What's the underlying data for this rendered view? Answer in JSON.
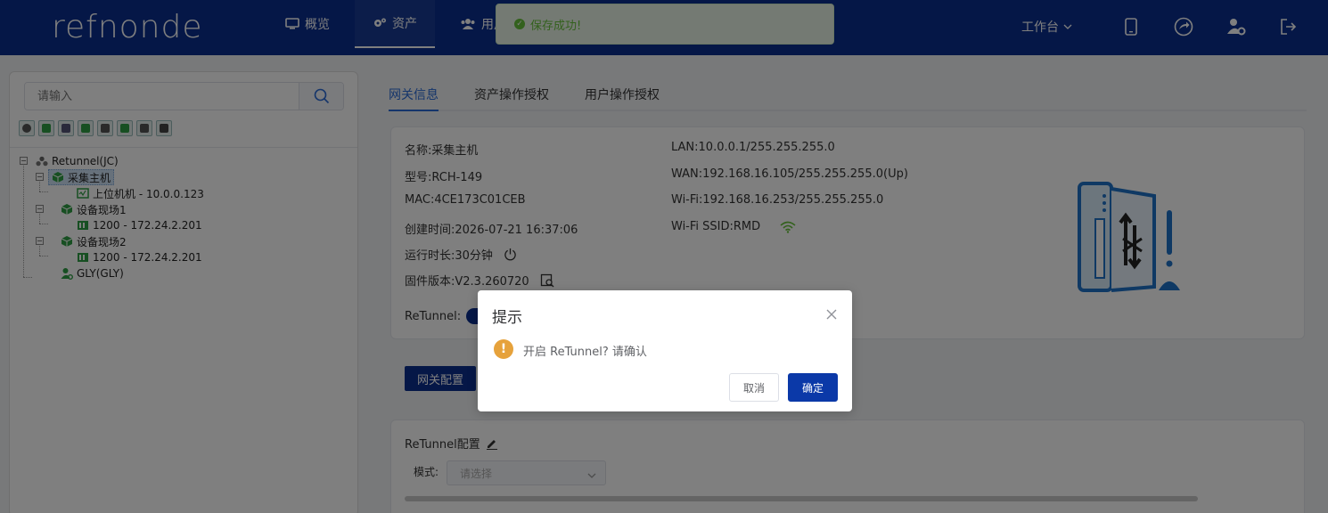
{
  "header": {
    "logo": "refnonde",
    "nav": [
      {
        "label": "概览",
        "icon": "monitor-icon"
      },
      {
        "label": "资产",
        "icon": "gears-icon"
      },
      {
        "label": "用户",
        "icon": "users-icon"
      }
    ],
    "toast": "保存成功!",
    "workbench": "工作台"
  },
  "sidebar": {
    "search_placeholder": "请输入",
    "tree": {
      "root": "Retunnel(JC)",
      "items": [
        {
          "label": "采集主机",
          "selected": true
        },
        {
          "label": "上位机机 - 10.0.0.123"
        },
        {
          "label": "设备现场1"
        },
        {
          "label": "1200 - 172.24.2.201"
        },
        {
          "label": "设备现场2"
        },
        {
          "label": "1200 - 172.24.2.201"
        },
        {
          "label": "GLY(GLY)"
        }
      ]
    }
  },
  "tabs": [
    {
      "label": "网关信息",
      "active": true
    },
    {
      "label": "资产操作授权"
    },
    {
      "label": "用户操作授权"
    }
  ],
  "gateway": {
    "name": "名称:采集主机",
    "model": "型号:RCH-149",
    "mac": "MAC:4CE173C01CEB",
    "created": "创建时间:2026-07-21 16:37:06",
    "uptime": "运行时长:30分钟",
    "firmware": "固件版本:V2.3.260720",
    "retunnel": "ReTunnel:",
    "lan": "LAN:10.0.0.1/255.255.255.0",
    "wan": "WAN:192.168.16.105/255.255.255.0(Up)",
    "wifi": "Wi-Fi:192.168.16.253/255.255.255.0",
    "wifi_ssid": "Wi-Fi SSID:RMD"
  },
  "config_button": "网关配置",
  "retunnel_config": {
    "title": "ReTunnel配置",
    "mode_label": "模式:",
    "mode_placeholder": "请选择"
  },
  "dialog": {
    "title": "提示",
    "message": "开启 ReTunnel? 请确认",
    "cancel": "取消",
    "ok": "确定"
  },
  "colors": {
    "header": "#0b2f8f",
    "primary": "#0b39a8",
    "tab_active": "#2a6bd6",
    "warning": "#e6a23c",
    "success": "#67c23a"
  }
}
